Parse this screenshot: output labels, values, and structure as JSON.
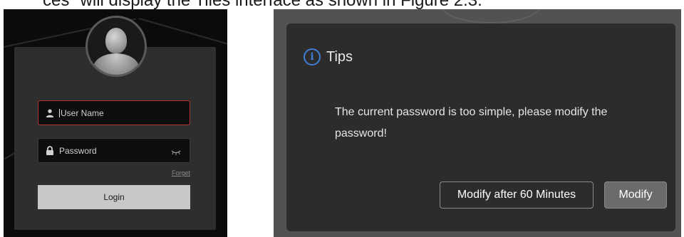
{
  "caption": {
    "text": "ces\" will display the Tiles interface as shown in Figure 2.3."
  },
  "login": {
    "username_placeholder": "User Name",
    "password_placeholder": "Password",
    "forget_label": "Forget",
    "login_label": "Login",
    "icons": {
      "user": "user-icon",
      "lock": "lock-icon",
      "eye": "eye-closed-icon",
      "avatar": "avatar-icon"
    }
  },
  "dialog": {
    "title": "Tips",
    "message": "The current password is too simple, please modify the password!",
    "modify_later_label": "Modify after 60 Minutes",
    "modify_label": "Modify",
    "icons": {
      "info": "info-icon"
    },
    "colors": {
      "info": "#3f7fd6"
    }
  }
}
